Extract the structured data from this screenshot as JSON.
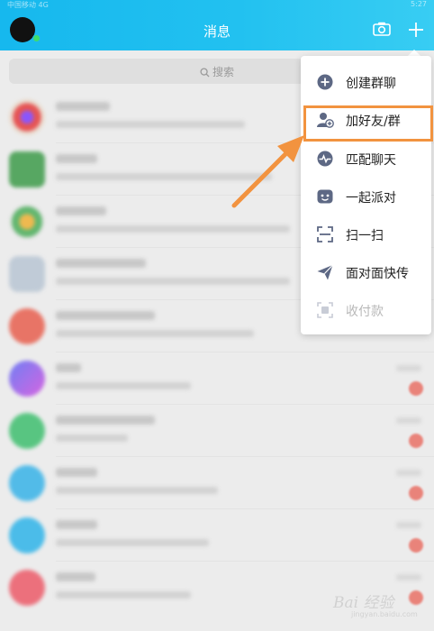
{
  "header": {
    "title": "消息",
    "status_left": "中国移动 4G",
    "status_right": "5:27"
  },
  "search": {
    "placeholder": "搜索"
  },
  "menu": {
    "items": [
      {
        "label": "创建群聊",
        "icon": "add-group-icon"
      },
      {
        "label": "加好友/群",
        "icon": "add-friend-icon",
        "highlighted": true
      },
      {
        "label": "匹配聊天",
        "icon": "match-chat-icon"
      },
      {
        "label": "一起派对",
        "icon": "party-icon"
      },
      {
        "label": "扫一扫",
        "icon": "scan-icon"
      },
      {
        "label": "面对面快传",
        "icon": "face-to-face-transfer-icon"
      },
      {
        "label": "收付款",
        "icon": "payment-icon",
        "disabled": true
      }
    ]
  },
  "watermark": {
    "main": "Bai 经验",
    "sub": "jingyan.baidu.com"
  },
  "colors": {
    "header": "#1fbbee",
    "highlight": "#f2933f",
    "badge": "#e8574a"
  }
}
